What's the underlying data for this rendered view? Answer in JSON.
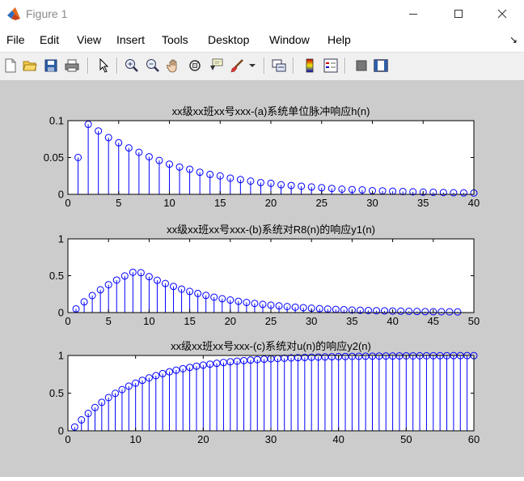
{
  "window": {
    "title": "Figure 1"
  },
  "menu": {
    "items": [
      "File",
      "Edit",
      "View",
      "Insert",
      "Tools",
      "Desktop",
      "Window",
      "Help"
    ]
  },
  "toolbar": {
    "icons": [
      "new-figure-icon",
      "open-file-icon",
      "save-icon",
      "print-icon",
      "pointer-icon",
      "zoom-in-icon",
      "zoom-out-icon",
      "pan-icon",
      "rotate-3d-icon",
      "data-cursor-icon",
      "brush-icon",
      "brush-dropdown-icon",
      "link-plot-icon",
      "insert-colorbar-icon",
      "insert-legend-icon",
      "hide-plot-tools-icon",
      "show-plot-tools-icon"
    ]
  },
  "colors": {
    "stem": "#0000ff",
    "figure_bg": "#cccccc",
    "axes_bg": "#ffffff"
  },
  "chart_data": [
    {
      "type": "stem",
      "title": "xx级xx班xx号xxx-(a)系统单位脉冲响应h(n)",
      "xlim": [
        0,
        40
      ],
      "ylim": [
        0,
        0.1
      ],
      "xticks": [
        0,
        5,
        10,
        15,
        20,
        25,
        30,
        35,
        40
      ],
      "yticks": [
        0,
        0.05,
        0.1
      ],
      "ytick_labels": [
        "0",
        "0.05",
        "0.1"
      ],
      "x": [
        1,
        2,
        3,
        4,
        5,
        6,
        7,
        8,
        9,
        10,
        11,
        12,
        13,
        14,
        15,
        16,
        17,
        18,
        19,
        20,
        21,
        22,
        23,
        24,
        25,
        26,
        27,
        28,
        29,
        30,
        31,
        32,
        33,
        34,
        35,
        36,
        37,
        38,
        39,
        40
      ],
      "y": [
        0.05,
        0.095,
        0.086,
        0.077,
        0.07,
        0.063,
        0.057,
        0.051,
        0.046,
        0.041,
        0.037,
        0.034,
        0.03,
        0.027,
        0.025,
        0.022,
        0.02,
        0.018,
        0.016,
        0.015,
        0.013,
        0.012,
        0.011,
        0.01,
        0.009,
        0.008,
        0.007,
        0.0065,
        0.006,
        0.005,
        0.0047,
        0.0042,
        0.0038,
        0.0034,
        0.003,
        0.0028,
        0.0025,
        0.0022,
        0.002,
        0.0018
      ]
    },
    {
      "type": "stem",
      "title": "xx级xx班xx号xxx-(b)系统对R8(n)的响应y1(n)",
      "xlim": [
        0,
        50
      ],
      "ylim": [
        0,
        1
      ],
      "xticks": [
        0,
        5,
        10,
        15,
        20,
        25,
        30,
        35,
        40,
        45,
        50
      ],
      "yticks": [
        0,
        0.5,
        1
      ],
      "ytick_labels": [
        "0",
        "0.5",
        "1"
      ],
      "x": [
        1,
        2,
        3,
        4,
        5,
        6,
        7,
        8,
        9,
        10,
        11,
        12,
        13,
        14,
        15,
        16,
        17,
        18,
        19,
        20,
        21,
        22,
        23,
        24,
        25,
        26,
        27,
        28,
        29,
        30,
        31,
        32,
        33,
        34,
        35,
        36,
        37,
        38,
        39,
        40,
        41,
        42,
        43,
        44,
        45,
        46,
        47,
        48
      ],
      "y": [
        0.05,
        0.145,
        0.231,
        0.309,
        0.378,
        0.441,
        0.497,
        0.547,
        0.541,
        0.487,
        0.438,
        0.394,
        0.355,
        0.319,
        0.287,
        0.259,
        0.233,
        0.209,
        0.188,
        0.17,
        0.153,
        0.137,
        0.124,
        0.111,
        0.1,
        0.09,
        0.081,
        0.073,
        0.066,
        0.059,
        0.053,
        0.048,
        0.043,
        0.039,
        0.035,
        0.031,
        0.028,
        0.025,
        0.023,
        0.021,
        0.019,
        0.017,
        0.015,
        0.013,
        0.012,
        0.011,
        0.01,
        0.009
      ]
    },
    {
      "type": "stem",
      "title": "xx级xx班xx号xxx-(c)系统对u(n)的响应y2(n)",
      "xlim": [
        0,
        60
      ],
      "ylim": [
        0,
        1
      ],
      "xticks": [
        0,
        10,
        20,
        30,
        40,
        50,
        60
      ],
      "yticks": [
        0,
        0.5,
        1
      ],
      "ytick_labels": [
        "0",
        "0.5",
        "1"
      ],
      "x": [
        1,
        2,
        3,
        4,
        5,
        6,
        7,
        8,
        9,
        10,
        11,
        12,
        13,
        14,
        15,
        16,
        17,
        18,
        19,
        20,
        21,
        22,
        23,
        24,
        25,
        26,
        27,
        28,
        29,
        30,
        31,
        32,
        33,
        34,
        35,
        36,
        37,
        38,
        39,
        40,
        41,
        42,
        43,
        44,
        45,
        46,
        47,
        48,
        49,
        50,
        51,
        52,
        53,
        54,
        55,
        56,
        57,
        58,
        59,
        60
      ],
      "y": [
        0.05,
        0.145,
        0.231,
        0.309,
        0.378,
        0.441,
        0.497,
        0.547,
        0.593,
        0.633,
        0.67,
        0.703,
        0.732,
        0.759,
        0.783,
        0.805,
        0.824,
        0.842,
        0.858,
        0.872,
        0.885,
        0.896,
        0.907,
        0.916,
        0.925,
        0.932,
        0.939,
        0.945,
        0.951,
        0.956,
        0.96,
        0.964,
        0.968,
        0.971,
        0.974,
        0.977,
        0.979,
        0.981,
        0.983,
        0.985,
        0.986,
        0.988,
        0.989,
        0.99,
        0.991,
        0.992,
        0.993,
        0.993,
        0.994,
        0.995,
        0.995,
        0.996,
        0.996,
        0.997,
        0.997,
        0.997,
        0.998,
        0.998,
        0.998,
        0.998
      ]
    }
  ]
}
